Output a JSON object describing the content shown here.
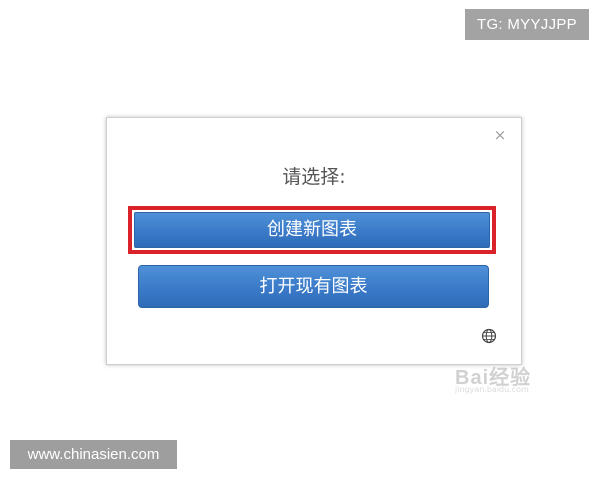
{
  "watermarks": {
    "top_right": "TG: MYYJJPP",
    "bottom_left": "www.chinasien.com",
    "brand": "Bai经验",
    "brand_sub": "jingyan.baidu.com"
  },
  "dialog": {
    "close_symbol": "×",
    "prompt": "请选择:",
    "buttons": {
      "create": "创建新图表",
      "open": "打开现有图表"
    },
    "globe_icon": "globe-icon"
  },
  "colors": {
    "button_blue": "#3a7ac8",
    "highlight_red": "#d9222a",
    "badge_gray": "#a3a3a3"
  }
}
